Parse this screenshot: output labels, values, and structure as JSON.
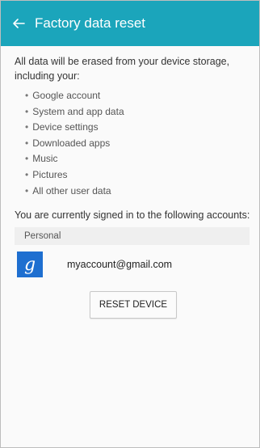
{
  "header": {
    "back_icon": "arrow-back-icon",
    "title": "Factory data reset",
    "color": "#1ba5bb"
  },
  "intro_text": "All data will be erased from your device storage, including your:",
  "data_items": [
    "Google account",
    "System and app data",
    "Device settings",
    "Downloaded apps",
    "Music",
    "Pictures",
    "All other user data"
  ],
  "signed_in_text": "You are currently signed in to the following accounts:",
  "accounts_section": {
    "label": "Personal",
    "accounts": [
      {
        "icon": "google-icon",
        "email": "myaccount@gmail.com"
      }
    ]
  },
  "reset_button_label": "RESET DEVICE"
}
